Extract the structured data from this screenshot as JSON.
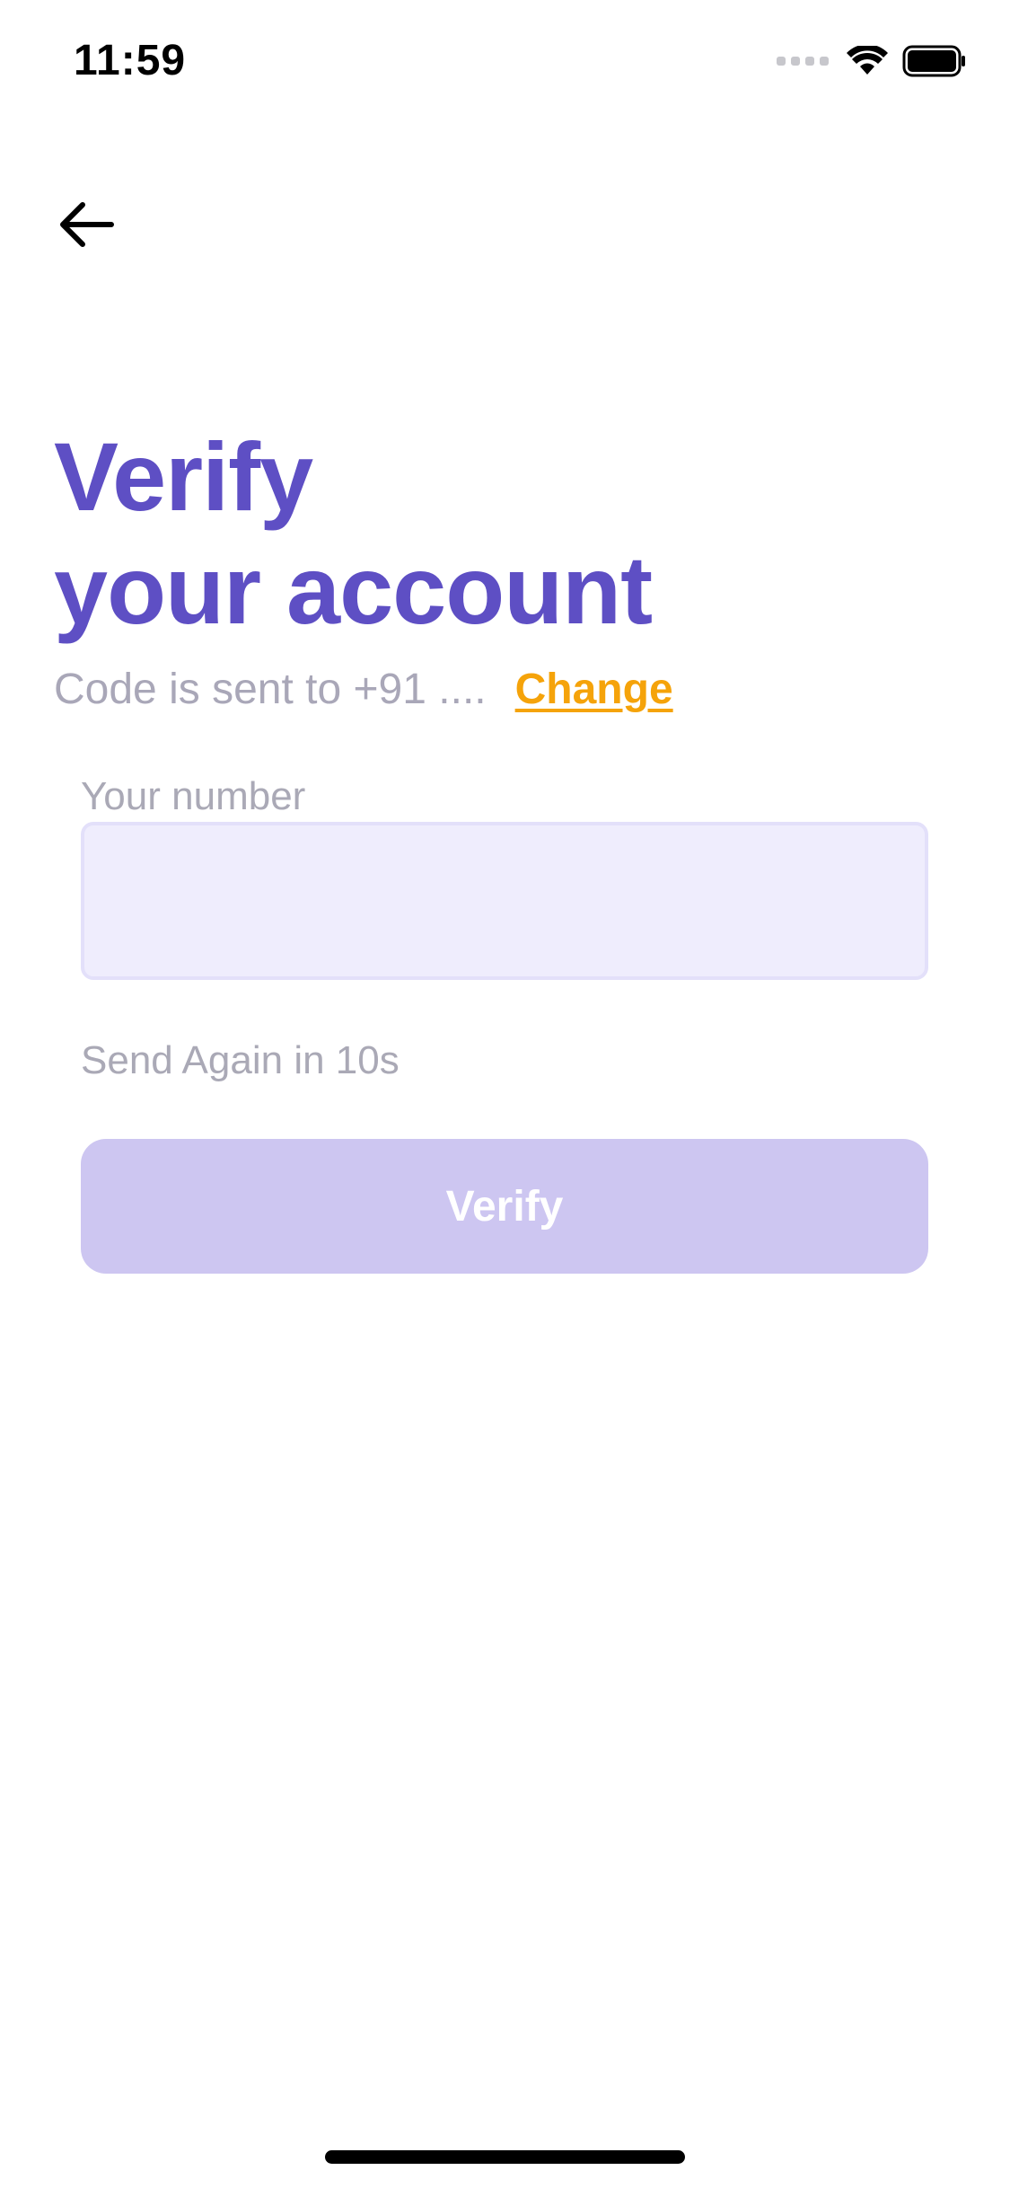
{
  "status_bar": {
    "time": "11:59",
    "icons": [
      "signal-icon",
      "wifi-icon",
      "battery-icon"
    ]
  },
  "nav": {
    "back_icon": "arrow-left-icon"
  },
  "header": {
    "title_line1": "Verify",
    "title_line2": "your account"
  },
  "subtitle": {
    "text": "Code is sent to +91 ....",
    "change_link": "Change"
  },
  "form": {
    "number_label": "Your number",
    "number_value": "",
    "resend_text": "Send Again in 10s",
    "verify_label": "Verify"
  },
  "colors": {
    "primary": "#5e4fc4",
    "accent": "#f5a30a",
    "input_bg": "#efedfd",
    "button_disabled": "#cdc6f1",
    "muted_text": "#a9a7b8"
  }
}
